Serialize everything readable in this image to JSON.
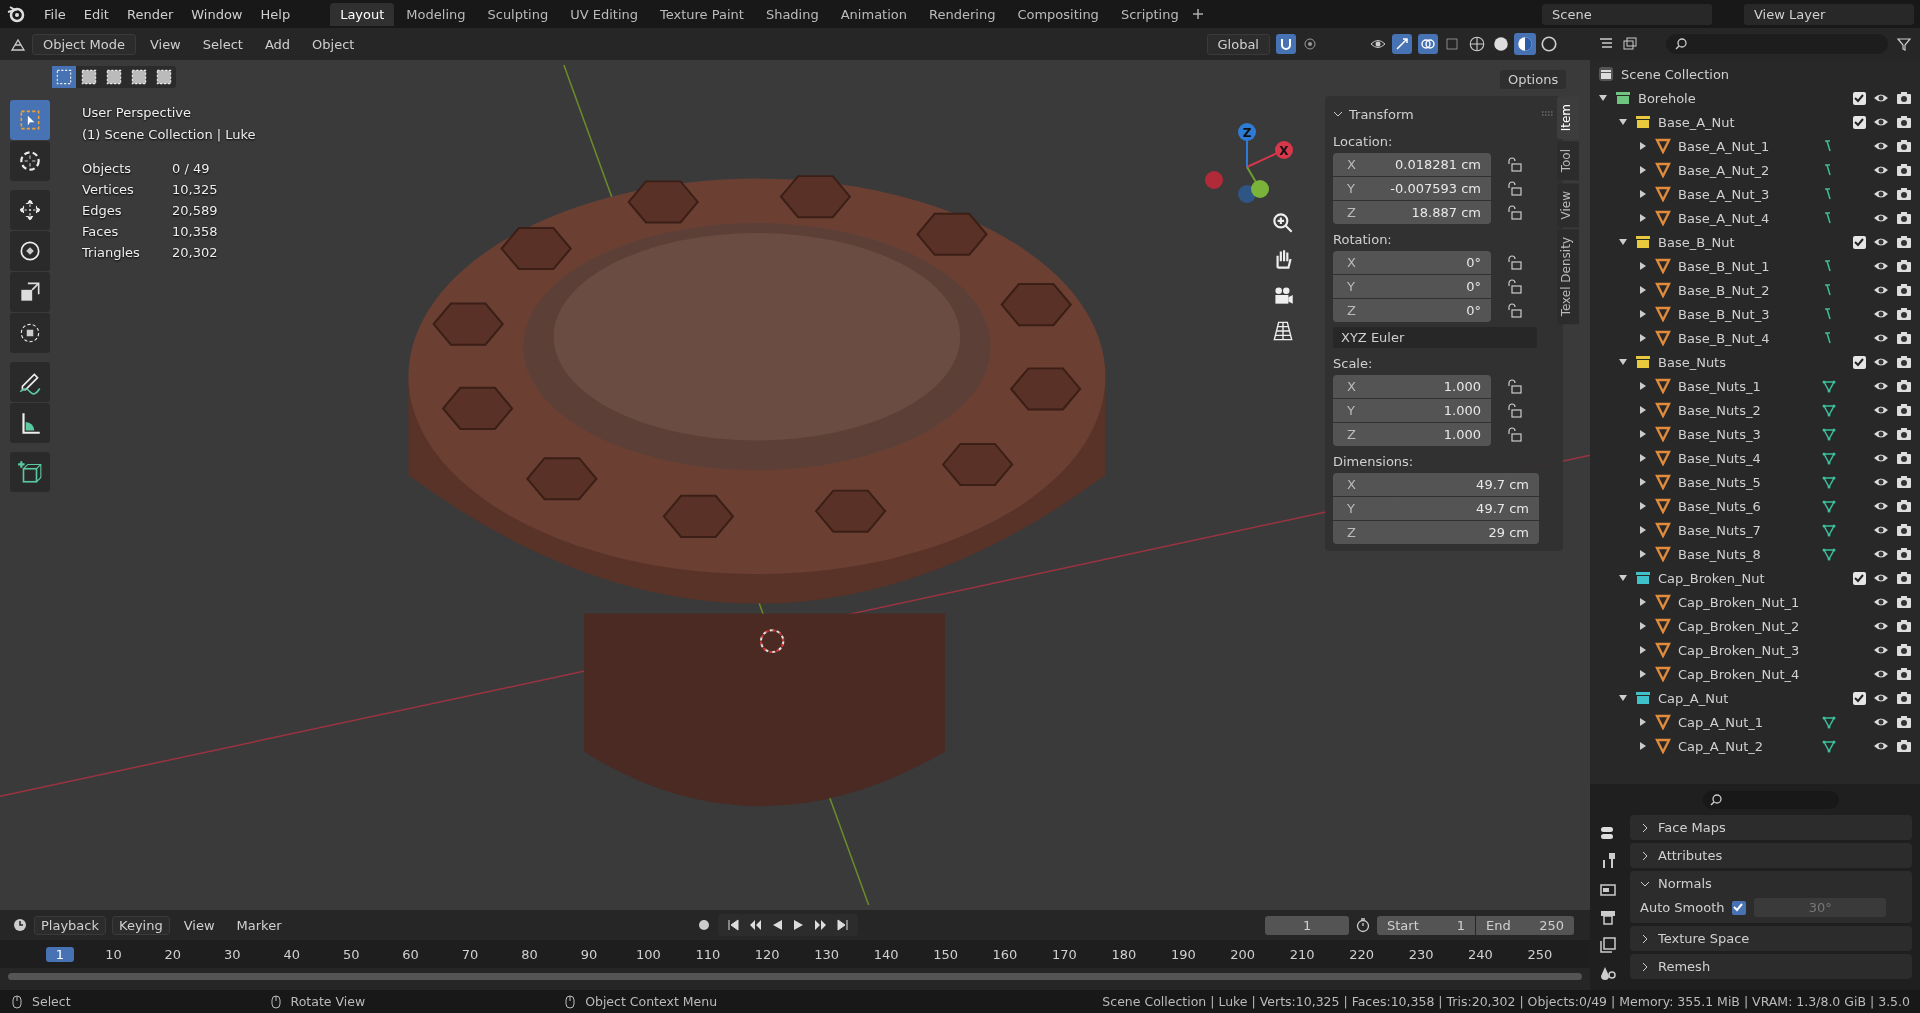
{
  "menu": [
    "File",
    "Edit",
    "Render",
    "Window",
    "Help"
  ],
  "workspaces": [
    {
      "label": "Layout",
      "selected": true
    },
    {
      "label": "Modeling",
      "selected": false
    },
    {
      "label": "Sculpting",
      "selected": false
    },
    {
      "label": "UV Editing",
      "selected": false
    },
    {
      "label": "Texture Paint",
      "selected": false
    },
    {
      "label": "Shading",
      "selected": false
    },
    {
      "label": "Animation",
      "selected": false
    },
    {
      "label": "Rendering",
      "selected": false
    },
    {
      "label": "Compositing",
      "selected": false
    },
    {
      "label": "Scripting",
      "selected": false
    }
  ],
  "scene": "Scene",
  "view_layer": "View Layer",
  "viewport_header": {
    "mode": "Object Mode",
    "menus": [
      "View",
      "Select",
      "Add",
      "Object"
    ],
    "orientation": "Global",
    "snap_on": true,
    "shading_modes": [
      {
        "kind": "wire",
        "selected": false
      },
      {
        "kind": "solid",
        "selected": false
      },
      {
        "kind": "material",
        "selected": true
      },
      {
        "kind": "rendered",
        "selected": false
      }
    ]
  },
  "options": "Options",
  "select_modes": [
    {
      "selected": true
    },
    {
      "selected": false
    },
    {
      "selected": false
    },
    {
      "selected": false
    },
    {
      "selected": false
    }
  ],
  "tools": [
    {
      "kind": "select",
      "selected": true
    },
    {
      "kind": "cursor",
      "selected": false
    },
    {
      "kind": "move",
      "selected": false
    },
    {
      "kind": "rotate",
      "selected": false
    },
    {
      "kind": "scale",
      "selected": false
    },
    {
      "kind": "transform",
      "selected": false
    },
    {
      "kind": "annotate",
      "selected": false
    },
    {
      "kind": "measure",
      "selected": false
    },
    {
      "kind": "add-cube",
      "selected": false
    }
  ],
  "overlay": {
    "title": "User Perspective",
    "subtitle": "(1) Scene Collection | Luke",
    "stats": [
      {
        "label": "Objects",
        "value": "0 / 49"
      },
      {
        "label": "Vertices",
        "value": "10,325"
      },
      {
        "label": "Edges",
        "value": "20,589"
      },
      {
        "label": "Faces",
        "value": "10,358"
      },
      {
        "label": "Triangles",
        "value": "20,302"
      }
    ]
  },
  "gizmo": [
    {
      "label": "Z",
      "color": "#2e7bd6"
    },
    {
      "label": "X",
      "color": "#d6374b"
    }
  ],
  "transform": {
    "title": "Transform",
    "rotation_mode": "XYZ Euler",
    "sections": [
      {
        "label": "Location:",
        "lock": true,
        "rows": [
          {
            "axis": "X",
            "value": "0.018281 cm"
          },
          {
            "axis": "Y",
            "value": "-0.007593 cm"
          },
          {
            "axis": "Z",
            "value": "18.887 cm"
          }
        ]
      },
      {
        "label": "Rotation:",
        "lock": true,
        "rows": [
          {
            "axis": "X",
            "value": "0°"
          },
          {
            "axis": "Y",
            "value": "0°"
          },
          {
            "axis": "Z",
            "value": "0°"
          }
        ]
      },
      {
        "label": "Scale:",
        "lock": true,
        "rows": [
          {
            "axis": "X",
            "value": "1.000"
          },
          {
            "axis": "Y",
            "value": "1.000"
          },
          {
            "axis": "Z",
            "value": "1.000"
          }
        ]
      },
      {
        "label": "Dimensions:",
        "lock": false,
        "rows": [
          {
            "axis": "X",
            "value": "49.7 cm"
          },
          {
            "axis": "Y",
            "value": "49.7 cm"
          },
          {
            "axis": "Z",
            "value": "29 cm"
          }
        ]
      }
    ]
  },
  "sidebar_tabs": [
    {
      "label": "Item",
      "selected": true
    },
    {
      "label": "Tool",
      "selected": false
    },
    {
      "label": "View",
      "selected": false
    },
    {
      "label": "Texel Density",
      "selected": false
    }
  ],
  "outliner": {
    "root": "Scene Collection",
    "tree": [
      {
        "kind": "collection",
        "name": "Borehole",
        "color": "#6fc47f",
        "checked": true,
        "children": [
          {
            "kind": "collection",
            "name": "Base_A_Nut",
            "color": "#e8c93c",
            "checked": true,
            "children": [
              {
                "kind": "vertex-object",
                "name": "Base_A_Nut_1"
              },
              {
                "kind": "vertex-object",
                "name": "Base_A_Nut_2"
              },
              {
                "kind": "vertex-object",
                "name": "Base_A_Nut_3"
              },
              {
                "kind": "vertex-object",
                "name": "Base_A_Nut_4"
              }
            ]
          },
          {
            "kind": "collection",
            "name": "Base_B_Nut",
            "color": "#e8c93c",
            "checked": true,
            "children": [
              {
                "kind": "vertex-object",
                "name": "Base_B_Nut_1"
              },
              {
                "kind": "vertex-object",
                "name": "Base_B_Nut_2"
              },
              {
                "kind": "vertex-object",
                "name": "Base_B_Nut_3"
              },
              {
                "kind": "vertex-object",
                "name": "Base_B_Nut_4"
              }
            ]
          },
          {
            "kind": "collection",
            "name": "Base_Nuts",
            "color": "#e8c93c",
            "checked": true,
            "children": [
              {
                "kind": "mesh-object",
                "name": "Base_Nuts_1"
              },
              {
                "kind": "mesh-object",
                "name": "Base_Nuts_2"
              },
              {
                "kind": "mesh-object",
                "name": "Base_Nuts_3"
              },
              {
                "kind": "mesh-object",
                "name": "Base_Nuts_4"
              },
              {
                "kind": "mesh-object",
                "name": "Base_Nuts_5"
              },
              {
                "kind": "mesh-object",
                "name": "Base_Nuts_6"
              },
              {
                "kind": "mesh-object",
                "name": "Base_Nuts_7"
              },
              {
                "kind": "mesh-object",
                "name": "Base_Nuts_8"
              }
            ]
          },
          {
            "kind": "collection",
            "name": "Cap_Broken_Nut",
            "color": "#3fc1c9",
            "checked": true,
            "children": [
              {
                "kind": "object",
                "name": "Cap_Broken_Nut_1"
              },
              {
                "kind": "object",
                "name": "Cap_Broken_Nut_2"
              },
              {
                "kind": "object",
                "name": "Cap_Broken_Nut_3"
              },
              {
                "kind": "object",
                "name": "Cap_Broken_Nut_4"
              }
            ]
          },
          {
            "kind": "collection",
            "name": "Cap_A_Nut",
            "color": "#3fc1c9",
            "checked": true,
            "children": [
              {
                "kind": "mesh-object",
                "name": "Cap_A_Nut_1"
              },
              {
                "kind": "mesh-object",
                "name": "Cap_A_Nut_2"
              }
            ]
          }
        ]
      }
    ]
  },
  "properties": {
    "panels": [
      {
        "label": "Face Maps",
        "expanded": false
      },
      {
        "label": "Attributes",
        "expanded": false
      },
      {
        "label": "Normals",
        "expanded": true,
        "auto_smooth": {
          "label": "Auto Smooth",
          "checked": true,
          "angle": "30°"
        }
      },
      {
        "label": "Texture Space",
        "expanded": false
      },
      {
        "label": "Remesh",
        "expanded": false
      }
    ]
  },
  "timeline": {
    "menus": [
      "Playback",
      "Keying",
      "View",
      "Marker"
    ],
    "current_frame": "1",
    "start_label": "Start",
    "start": "1",
    "end_label": "End",
    "end": "250",
    "ticks": [
      {
        "label": "1",
        "selected": true
      },
      {
        "label": "10",
        "selected": false
      },
      {
        "label": "20",
        "selected": false
      },
      {
        "label": "30",
        "selected": false
      },
      {
        "label": "40",
        "selected": false
      },
      {
        "label": "50",
        "selected": false
      },
      {
        "label": "60",
        "selected": false
      },
      {
        "label": "70",
        "selected": false
      },
      {
        "label": "80",
        "selected": false
      },
      {
        "label": "90",
        "selected": false
      },
      {
        "label": "100",
        "selected": false
      },
      {
        "label": "110",
        "selected": false
      },
      {
        "label": "120",
        "selected": false
      },
      {
        "label": "130",
        "selected": false
      },
      {
        "label": "140",
        "selected": false
      },
      {
        "label": "150",
        "selected": false
      },
      {
        "label": "160",
        "selected": false
      },
      {
        "label": "170",
        "selected": false
      },
      {
        "label": "180",
        "selected": false
      },
      {
        "label": "190",
        "selected": false
      },
      {
        "label": "200",
        "selected": false
      },
      {
        "label": "210",
        "selected": false
      },
      {
        "label": "220",
        "selected": false
      },
      {
        "label": "230",
        "selected": false
      },
      {
        "label": "240",
        "selected": false
      },
      {
        "label": "250",
        "selected": false
      }
    ]
  },
  "status_bar": {
    "hints": [
      "Select",
      "Rotate View",
      "Object Context Menu"
    ],
    "info": "Scene Collection | Luke | Verts:10,325 | Faces:10,358 | Tris:20,302 | Objects:0/49 | Memory: 355.1 MiB | VRAM: 1.3/8.0 GiB | 3.5.0"
  }
}
